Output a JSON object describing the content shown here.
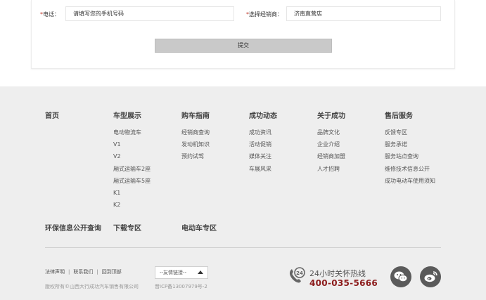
{
  "form": {
    "phone_label": "电话：",
    "phone_placeholder": "请填写您的手机号码",
    "dealer_label": "选择经销商：",
    "dealer_value": "济南直营店",
    "required_mark": "*",
    "submit_label": "提交"
  },
  "footer": {
    "columns": [
      {
        "title": "首页",
        "items": []
      },
      {
        "title": "车型展示",
        "items": [
          "电动物流车",
          "V1",
          "V2",
          "厢式运输车2座",
          "厢式运输车5座",
          "K1",
          "K2"
        ]
      },
      {
        "title": "购车指南",
        "items": [
          "经销商查询",
          "发动机知识",
          "预约试驾"
        ]
      },
      {
        "title": "成功动态",
        "items": [
          "成功资讯",
          "活动促销",
          "媒体关注",
          "车展风采"
        ]
      },
      {
        "title": "关于成功",
        "items": [
          "品牌文化",
          "企业介绍",
          "经销商加盟",
          "人才招聘"
        ]
      },
      {
        "title": "售后服务",
        "items": [
          "反馈专区",
          "服务承诺",
          "服务站点查询",
          "维修技术信息公开",
          "成功电动车使用须知"
        ]
      }
    ],
    "secondary": [
      "环保信息公开查询",
      "下载专区",
      "电动车专区"
    ],
    "links": [
      "法律声明",
      "联系我们",
      "回到顶部"
    ],
    "link_sep": "|",
    "friend_links_select": "--友情链接--",
    "copyright": "版权所有©山西大行成功汽车销售有限公司",
    "icp": "晋ICP备13007979号-2",
    "hotline_label": "24小时关怀热线",
    "hotline_number": "400-035-5666",
    "hotline_badge": "24"
  }
}
